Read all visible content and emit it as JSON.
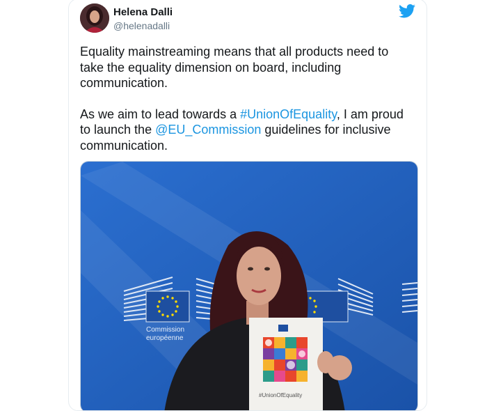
{
  "tweet": {
    "display_name": "Helena Dalli",
    "handle": "@helenadalli",
    "text_1": "Equality mainstreaming means that all products need to take the equality dimension on board, including communication.",
    "text_2_pre": "As we aim to lead towards a ",
    "hashtag": "#UnionOfEquality",
    "text_2_mid": ", I am proud to launch the ",
    "mention": "@EU_Commission",
    "text_2_post": " guidelines for inclusive communication.",
    "twitter_icon": "twitter-bird-icon",
    "colors": {
      "link": "#1b95e0",
      "brand": "#1da1f2",
      "eu_blue": "#1f5fbf"
    }
  },
  "photo": {
    "logo_line1": "Commission",
    "logo_line2": "européenne",
    "booklet_hashtag": "#UnionOfEquality"
  }
}
